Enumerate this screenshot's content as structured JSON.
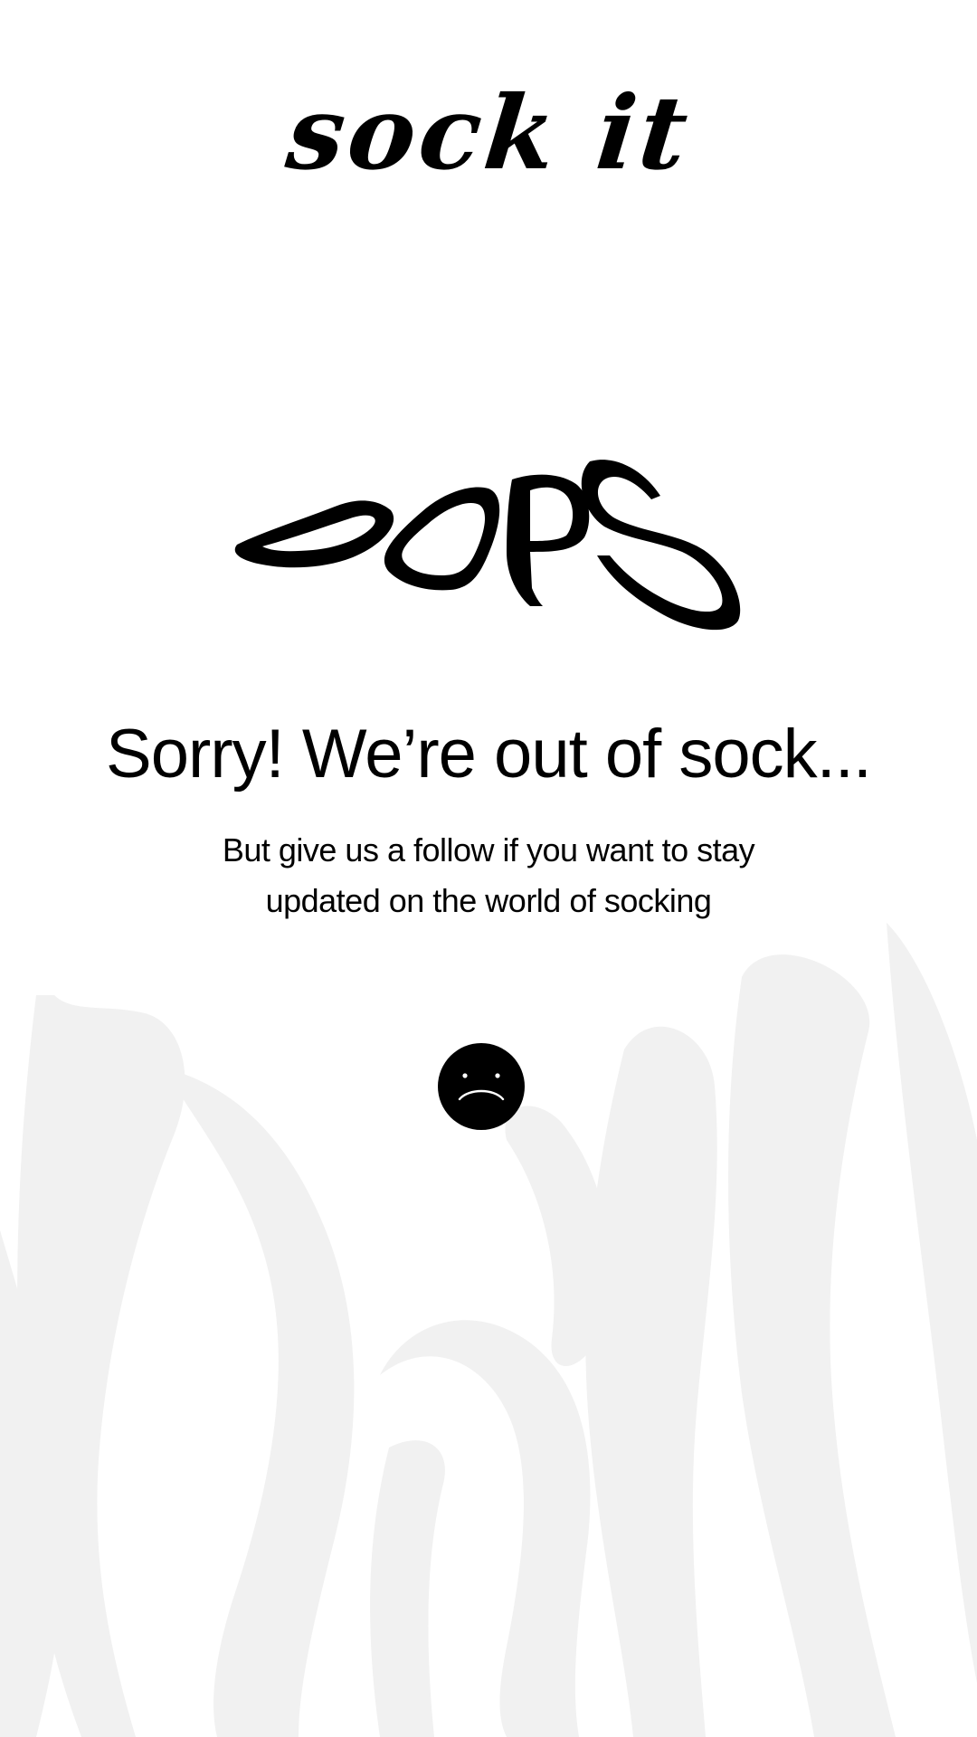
{
  "brand": {
    "logo_text": "sock it",
    "background_wordmark": "sock it"
  },
  "hero": {
    "oops_text": "OOPS",
    "headline": "Sorry! We’re out of sock...",
    "subtext_line1": "But give us a follow if you want to stay",
    "subtext_line2": "updated on the world of socking"
  },
  "follow_button": {
    "icon": "sad-face-icon"
  },
  "colors": {
    "background": "#ffffff",
    "text": "#000000",
    "background_art": "#f2f2f2"
  }
}
